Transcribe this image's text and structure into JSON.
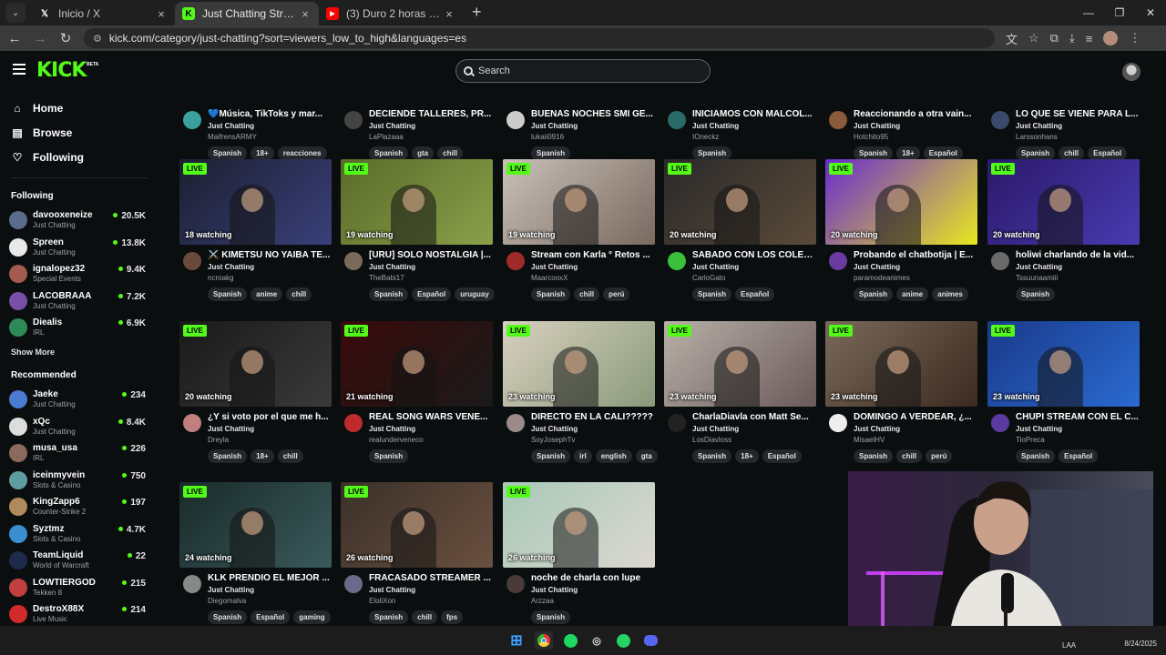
{
  "browser": {
    "tabs": [
      {
        "title": "Inicio / X",
        "active": false,
        "icon": "x-logo-icon"
      },
      {
        "title": "Just Chatting Streaming - Live",
        "active": true,
        "icon": "kick-logo-icon"
      },
      {
        "title": "(3) Duro 2 horas - Faraón Love",
        "active": false,
        "icon": "youtube-icon"
      }
    ],
    "url": "kick.com/category/just-chatting?sort=viewers_low_to_high&languages=es"
  },
  "header": {
    "logo": "KICK",
    "beta": "BETA",
    "search_placeholder": "Search"
  },
  "sidebar": {
    "nav": [
      {
        "label": "Home",
        "icon": "home-icon"
      },
      {
        "label": "Browse",
        "icon": "browse-icon"
      },
      {
        "label": "Following",
        "icon": "heart-icon"
      }
    ],
    "following_heading": "Following",
    "following": [
      {
        "name": "davooxeneize",
        "category": "Just Chatting",
        "viewers": "20.5K",
        "color": "#5a6b8c"
      },
      {
        "name": "Spreen",
        "category": "Just Chatting",
        "viewers": "13.8K",
        "color": "#e8e8e8"
      },
      {
        "name": "ignalopez32",
        "category": "Special Events",
        "viewers": "9.4K",
        "color": "#a35b4f"
      },
      {
        "name": "LACOBRAAA",
        "category": "Just Chatting",
        "viewers": "7.2K",
        "color": "#7a4fa8"
      },
      {
        "name": "Diealis",
        "category": "IRL",
        "viewers": "6.9K",
        "color": "#2e8b57"
      }
    ],
    "show_more": "Show More",
    "recommended_heading": "Recommended",
    "recommended": [
      {
        "name": "Jaeke",
        "category": "Just Chatting",
        "viewers": "234",
        "color": "#4a7bd1"
      },
      {
        "name": "xQc",
        "category": "Just Chatting",
        "viewers": "8.4K",
        "color": "#dddddd"
      },
      {
        "name": "musa_usa",
        "category": "IRL",
        "viewers": "226",
        "color": "#8a6a5a"
      },
      {
        "name": "iceinmyvein",
        "category": "Slots & Casino",
        "viewers": "750",
        "color": "#5f9ea0"
      },
      {
        "name": "KingZapp6",
        "category": "Counter-Strike 2",
        "viewers": "197",
        "color": "#b08a5c"
      },
      {
        "name": "Syztmz",
        "category": "Slots & Casino",
        "viewers": "4.7K",
        "color": "#3a8fd1"
      },
      {
        "name": "TeamLiquid",
        "category": "World of Warcraft",
        "viewers": "22",
        "color": "#1c2b4a"
      },
      {
        "name": "LOWTIERGOD",
        "category": "Tekken 8",
        "viewers": "215",
        "color": "#c04040"
      },
      {
        "name": "DestroX88X",
        "category": "Live Music",
        "viewers": "214",
        "color": "#d12a2a"
      }
    ]
  },
  "streams": [
    {
      "title": "💙Música, TikToks y mar...",
      "category": "Just Chatting",
      "channel": "MaifrensARMY",
      "tags": [
        "Spanish",
        "18+",
        "reacciones"
      ],
      "watching": "",
      "thumb": [
        "#222",
        "#333"
      ],
      "avatar": "#3aa0a0"
    },
    {
      "title": "DECIENDE TALLERES, PR...",
      "category": "Just Chatting",
      "channel": "LaPlazaaa",
      "tags": [
        "Spanish",
        "gta",
        "chill"
      ],
      "watching": "",
      "thumb": [
        "#222",
        "#333"
      ],
      "avatar": "#444"
    },
    {
      "title": "BUENAS NOCHES SMI GE...",
      "category": "Just Chatting",
      "channel": "lukaii0916",
      "tags": [
        "Spanish"
      ],
      "watching": "",
      "thumb": [
        "#222",
        "#333"
      ],
      "avatar": "#ccc"
    },
    {
      "title": "INICIAMOS CON MALCOL...",
      "category": "Just Chatting",
      "channel": "IOneckz",
      "tags": [
        "Spanish"
      ],
      "watching": "",
      "thumb": [
        "#222",
        "#333"
      ],
      "avatar": "#2a6a6a"
    },
    {
      "title": "Reaccionando a otra vain...",
      "category": "Just Chatting",
      "channel": "Hotchito95",
      "tags": [
        "Spanish",
        "18+",
        "Español"
      ],
      "watching": "",
      "thumb": [
        "#222",
        "#333"
      ],
      "avatar": "#8a5a3a"
    },
    {
      "title": "LO QUE SE VIENE PARA L...",
      "category": "Just Chatting",
      "channel": "Larssonhans",
      "tags": [
        "Spanish",
        "chill",
        "Español"
      ],
      "watching": "",
      "thumb": [
        "#222",
        "#333"
      ],
      "avatar": "#3a4a6a"
    },
    {
      "title": "⚔️ KIMETSU NO YAIBA TE...",
      "category": "Just Chatting",
      "channel": "ncroakg",
      "tags": [
        "Spanish",
        "anime",
        "chill"
      ],
      "watching": "18 watching",
      "thumb": [
        "#1c2030",
        "#3a3f7a"
      ],
      "avatar": "#6a4a3a"
    },
    {
      "title": "[URU] SOLO NOSTALGIA |...",
      "category": "Just Chatting",
      "channel": "TheBabi17",
      "tags": [
        "Spanish",
        "Español",
        "uruguay"
      ],
      "watching": "19 watching",
      "thumb": [
        "#5a6a2a",
        "#8aa04a"
      ],
      "avatar": "#7a6a5a"
    },
    {
      "title": "Stream con Karla ° Retos ...",
      "category": "Just Chatting",
      "channel": "MaarcooxX",
      "tags": [
        "Spanish",
        "chill",
        "perú"
      ],
      "watching": "19 watching",
      "thumb": [
        "#c8c0b8",
        "#7a6a60"
      ],
      "avatar": "#a02a2a"
    },
    {
      "title": "SABADO CON LOS COLES...",
      "category": "Just Chatting",
      "channel": "CarloGato",
      "tags": [
        "Spanish",
        "Español"
      ],
      "watching": "20 watching",
      "thumb": [
        "#2a2a2a",
        "#5a4a3a"
      ],
      "avatar": "#3ac03a"
    },
    {
      "title": "Probando el chatbotija | E...",
      "category": "Just Chatting",
      "channel": "paramodeanimes",
      "tags": [
        "Spanish",
        "anime",
        "animes"
      ],
      "watching": "20 watching",
      "thumb": [
        "#6a2ad0",
        "#e8e820"
      ],
      "avatar": "#6a3aa0"
    },
    {
      "title": "holiwi charlando de la vid...",
      "category": "Just Chatting",
      "channel": "Tssuunaamiii",
      "tags": [
        "Spanish"
      ],
      "watching": "20 watching",
      "thumb": [
        "#2a1a6a",
        "#4a3ab0"
      ],
      "avatar": "#6a6a6a"
    },
    {
      "title": "¿Y si voto por el que me h...",
      "category": "Just Chatting",
      "channel": "Dreyla",
      "tags": [
        "Spanish",
        "18+",
        "chill"
      ],
      "watching": "20 watching",
      "thumb": [
        "#1a1a1a",
        "#3a3a3a"
      ],
      "avatar": "#c08080"
    },
    {
      "title": "REAL SONG WARS VENE...",
      "category": "Just Chatting",
      "channel": "realunderveneco",
      "tags": [
        "Spanish"
      ],
      "watching": "21 watching",
      "thumb": [
        "#3a0a0a",
        "#1a1a1a"
      ],
      "avatar": "#c02a2a"
    },
    {
      "title": "DIRECTO EN LA CALI?????",
      "category": "Just Chatting",
      "channel": "SoyJosephTv",
      "tags": [
        "Spanish",
        "irl",
        "english",
        "gta"
      ],
      "watching": "23 watching",
      "thumb": [
        "#d8d0c0",
        "#8a9a7a"
      ],
      "avatar": "#9a8a8a"
    },
    {
      "title": "CharlaDiavla con Matt Se...",
      "category": "Just Chatting",
      "channel": "LosDiavloss",
      "tags": [
        "Spanish",
        "18+",
        "Español"
      ],
      "watching": "23 watching",
      "thumb": [
        "#b8b0a8",
        "#6a5a5a"
      ],
      "avatar": "#222"
    },
    {
      "title": "DOMINGO A VERDEAR, ¿...",
      "category": "Just Chatting",
      "channel": "MisaelHV",
      "tags": [
        "Spanish",
        "chill",
        "perú"
      ],
      "watching": "23 watching",
      "thumb": [
        "#7a6a5a",
        "#3a2a20"
      ],
      "avatar": "#eee"
    },
    {
      "title": "CHUPI STREAM CON EL C...",
      "category": "Just Chatting",
      "channel": "TioPreca",
      "tags": [
        "Spanish",
        "Español"
      ],
      "watching": "23 watching",
      "thumb": [
        "#1a3a8a",
        "#2a6ad0"
      ],
      "avatar": "#5a3aa0"
    },
    {
      "title": "KLK PRENDIO EL MEJOR ...",
      "category": "Just Chatting",
      "channel": "Diegomalva",
      "tags": [
        "Spanish",
        "Español",
        "gaming"
      ],
      "watching": "24 watching",
      "thumb": [
        "#1a2a2a",
        "#3a5a5a"
      ],
      "avatar": "#888"
    },
    {
      "title": "FRACASADO STREAMER ...",
      "category": "Just Chatting",
      "channel": "EloliXon",
      "tags": [
        "Spanish",
        "chill",
        "fps"
      ],
      "watching": "26 watching",
      "thumb": [
        "#3a3028",
        "#6a5040"
      ],
      "avatar": "#6a6a8a"
    },
    {
      "title": "noche de charla con lupe",
      "category": "Just Chatting",
      "channel": "Arzzaa",
      "tags": [
        "Spanish"
      ],
      "watching": "26 watching",
      "thumb": [
        "#a8c8b8",
        "#dcd8d0"
      ],
      "avatar": "#4a3a3a"
    }
  ],
  "live_label": "LIVE",
  "taskbar": {
    "lang": "LAA",
    "date": "8/24/2025"
  },
  "colors": {
    "accent": "#53fc18",
    "background": "#0b0e0f",
    "tag_bg": "#24272c"
  }
}
